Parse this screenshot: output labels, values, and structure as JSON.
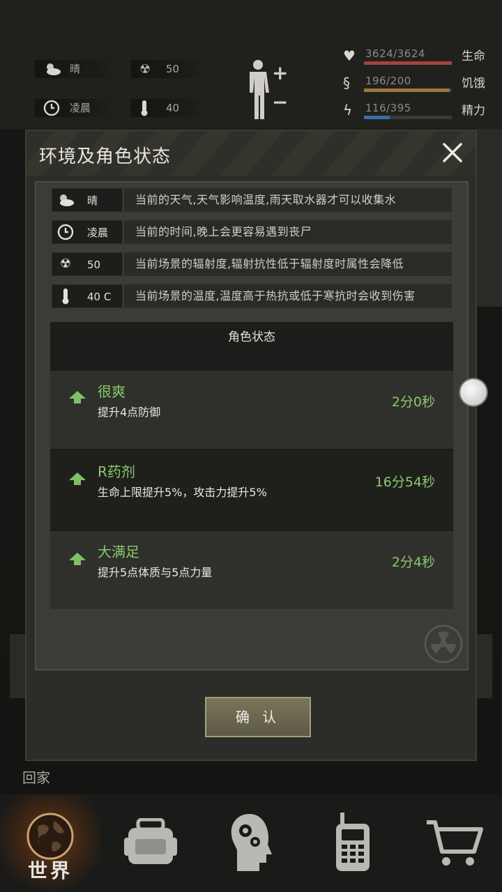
{
  "hud": {
    "weather": "晴",
    "radiation": "50",
    "time": "凌晨",
    "temperature": "40",
    "stats": [
      {
        "name": "生命",
        "value": "3624/3624",
        "fraction": 1.0,
        "color": "#a8413a"
      },
      {
        "name": "饥饿",
        "value": "196/200",
        "fraction": 0.98,
        "color": "#a0763a"
      },
      {
        "name": "精力",
        "value": "116/395",
        "fraction": 0.29,
        "color": "#3a6fa8"
      }
    ]
  },
  "background": {
    "home_label": "回家"
  },
  "dialog": {
    "title": "环境及角色状态",
    "env_rows": [
      {
        "icon": "weather-icon",
        "value": "晴",
        "desc": "当前的天气,天气影响温度,雨天取水器才可以收集水"
      },
      {
        "icon": "clock-icon",
        "value": "凌晨",
        "desc": "当前的时间,晚上会更容易遇到丧尸"
      },
      {
        "icon": "radiation-icon",
        "value": "50",
        "desc": "当前场景的辐射度,辐射抗性低于辐射度时属性会降低"
      },
      {
        "icon": "thermometer-icon",
        "value": "40 C",
        "desc": "当前场景的温度,温度高于热抗或低于寒抗时会收到伤害"
      }
    ],
    "status_header": "角色状态",
    "statuses": [
      {
        "name": "很爽",
        "desc": "提升4点防御",
        "time": "2分0秒"
      },
      {
        "name": "R药剂",
        "desc": "生命上限提升5%，攻击力提升5%",
        "time": "16分54秒"
      },
      {
        "name": "大满足",
        "desc": "提升5点体质与5点力量",
        "time": "2分4秒"
      }
    ],
    "confirm_label": "确 认"
  },
  "nav": {
    "items": [
      {
        "label": "世界",
        "icon": "globe-icon"
      },
      {
        "label": "",
        "icon": "backpack-icon"
      },
      {
        "label": "",
        "icon": "head-gears-icon"
      },
      {
        "label": "",
        "icon": "radio-icon"
      },
      {
        "label": "",
        "icon": "cart-icon"
      }
    ]
  }
}
